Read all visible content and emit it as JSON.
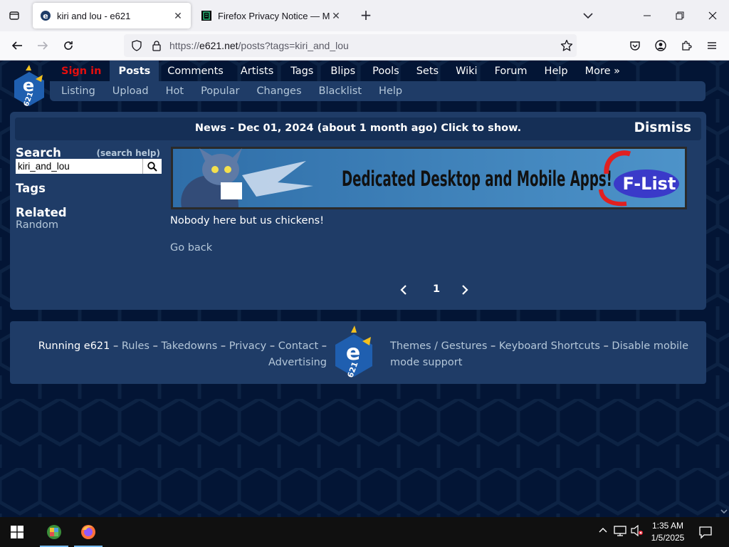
{
  "browser": {
    "tabs": [
      {
        "title": "kiri and lou - e621",
        "active": true,
        "favicon": "e621-favicon"
      },
      {
        "title": "Firefox Privacy Notice — Mozill",
        "active": false,
        "favicon": "firefox-doc-favicon"
      }
    ],
    "url": {
      "prefix": "https://",
      "host": "e621.net",
      "path": "/posts?tags=kiri_and_lou"
    }
  },
  "site": {
    "nav": {
      "signin": "Sign in",
      "items": [
        "Posts",
        "Comments",
        "Artists",
        "Tags",
        "Blips",
        "Pools",
        "Sets",
        "Wiki",
        "Forum",
        "Help",
        "More »"
      ],
      "active": "Posts"
    },
    "subnav": [
      "Listing",
      "Upload",
      "Hot",
      "Popular",
      "Changes",
      "Blacklist",
      "Help"
    ],
    "news": {
      "text": "News - Dec 01, 2024 (about 1 month ago) Click to show.",
      "dismiss": "Dismiss"
    },
    "sidebar": {
      "search_heading": "Search",
      "search_help": "(search help)",
      "search_value": "kiri_and_lou",
      "tags_heading": "Tags",
      "related_heading": "Related",
      "random_link": "Random"
    },
    "banner": {
      "text": "Dedicated Desktop and Mobile Apps!",
      "logo_text": "F-List"
    },
    "empty_message": "Nobody here but us chickens!",
    "go_back": "Go back",
    "paginator": {
      "current": "1"
    },
    "footer": {
      "running": "Running e621",
      "sep": "–",
      "left_links": [
        "Rules",
        "Takedowns",
        "Privacy",
        "Contact",
        "Advertising"
      ],
      "right_links": [
        "Themes / Gestures",
        "Keyboard Shortcuts",
        "Disable mobile mode support"
      ]
    },
    "colors": {
      "background": "#020f23",
      "section": "#1f3c67",
      "link": "#b4c7d9",
      "signin": "#e40e0e"
    }
  },
  "taskbar": {
    "time": "1:35 AM",
    "date": "1/5/2025",
    "apps": [
      "system-app-icon",
      "firefox-icon"
    ]
  }
}
